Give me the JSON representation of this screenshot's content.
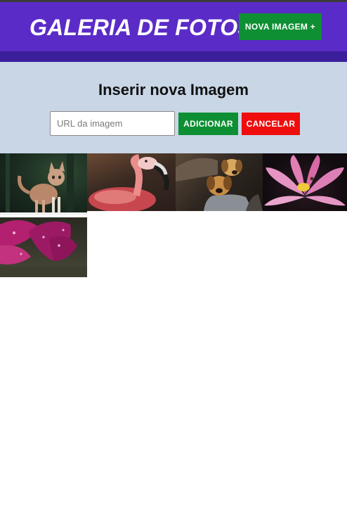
{
  "header": {
    "title": "GALERIA DE FOTOS",
    "new_image_button": "NOVA IMAGEM +",
    "background": "#5b2bc7"
  },
  "form": {
    "title": "Inserir nova Imagem",
    "url_placeholder": "URL da imagem",
    "url_value": "",
    "add_button": "ADICIONAR",
    "cancel_button": "CANCELAR",
    "add_color": "#0e8f33",
    "cancel_color": "#ef0d0d",
    "panel_background": "#c8d6e6"
  },
  "gallery": {
    "images": [
      {
        "subject": "cat"
      },
      {
        "subject": "flamingo"
      },
      {
        "subject": "puppies"
      },
      {
        "subject": "lotus-flower"
      },
      {
        "subject": "purple-petals"
      }
    ]
  }
}
